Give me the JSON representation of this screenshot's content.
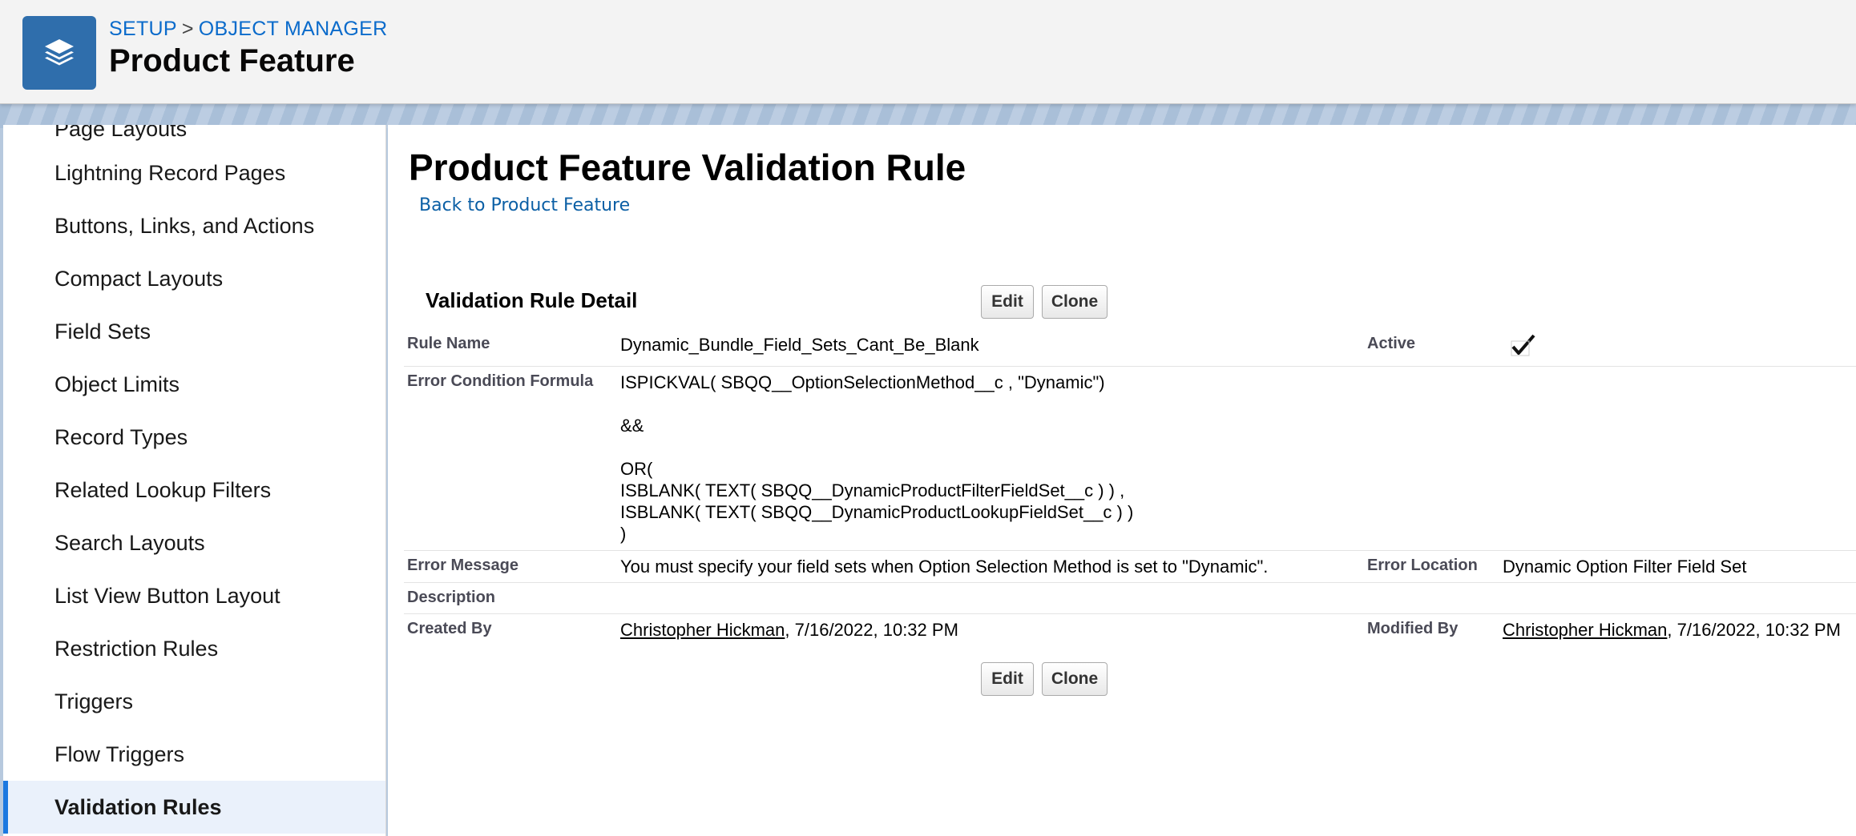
{
  "header": {
    "breadcrumb": {
      "setup": "SETUP",
      "separator": ">",
      "object_manager": "OBJECT MANAGER"
    },
    "title": "Product Feature",
    "icon": "layers-icon"
  },
  "sidebar": {
    "items": [
      {
        "label": "Page Layouts"
      },
      {
        "label": "Lightning Record Pages"
      },
      {
        "label": "Buttons, Links, and Actions"
      },
      {
        "label": "Compact Layouts"
      },
      {
        "label": "Field Sets"
      },
      {
        "label": "Object Limits"
      },
      {
        "label": "Record Types"
      },
      {
        "label": "Related Lookup Filters"
      },
      {
        "label": "Search Layouts"
      },
      {
        "label": "List View Button Layout"
      },
      {
        "label": "Restriction Rules"
      },
      {
        "label": "Triggers"
      },
      {
        "label": "Flow Triggers"
      },
      {
        "label": "Validation Rules"
      }
    ],
    "active": "Validation Rules"
  },
  "main": {
    "title": "Product Feature Validation Rule",
    "back_link": "Back to Product Feature",
    "section_title": "Validation Rule Detail",
    "buttons": {
      "edit": "Edit",
      "clone": "Clone"
    },
    "fields": {
      "rule_name_label": "Rule Name",
      "rule_name": "Dynamic_Bundle_Field_Sets_Cant_Be_Blank",
      "active_label": "Active",
      "active_checked": true,
      "formula_label": "Error Condition Formula",
      "formula_lines": [
        "ISPICKVAL( SBQQ__OptionSelectionMethod__c , \"Dynamic\")",
        "",
        "&&",
        "",
        "OR(",
        "ISBLANK( TEXT( SBQQ__DynamicProductFilterFieldSet__c ) ) ,",
        "ISBLANK( TEXT( SBQQ__DynamicProductLookupFieldSet__c ) )",
        ")"
      ],
      "error_message_label": "Error Message",
      "error_message": "You must specify your field sets when Option Selection Method is set to \"Dynamic\".",
      "error_location_label": "Error Location",
      "error_location": "Dynamic Option Filter Field Set",
      "description_label": "Description",
      "description": "",
      "created_by_label": "Created By",
      "created_by_user": "Christopher Hickman",
      "created_by_date": ", 7/16/2022, 10:32 PM",
      "modified_by_label": "Modified By",
      "modified_by_user": "Christopher Hickman",
      "modified_by_date": ", 7/16/2022, 10:32 PM"
    }
  },
  "colors": {
    "accent": "#0b6bcb",
    "icon_bg": "#2f6eac",
    "active_bar": "#1b78e0"
  }
}
